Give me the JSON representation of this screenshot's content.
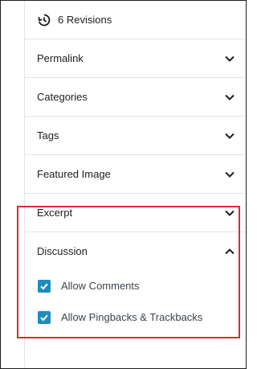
{
  "revisions": {
    "label": "6 Revisions",
    "icon": "history-icon"
  },
  "sections": [
    {
      "label": "Permalink",
      "expanded": false
    },
    {
      "label": "Categories",
      "expanded": false
    },
    {
      "label": "Tags",
      "expanded": false
    },
    {
      "label": "Featured Image",
      "expanded": false
    },
    {
      "label": "Excerpt",
      "expanded": false
    }
  ],
  "discussion": {
    "label": "Discussion",
    "expanded": true,
    "options": [
      {
        "label": "Allow Comments",
        "checked": true
      },
      {
        "label": "Allow Pingbacks & Trackbacks",
        "checked": true
      }
    ]
  },
  "colors": {
    "checkbox": "#1e8cbe",
    "highlight": "#d32f2f",
    "divider": "#e2e4e7"
  }
}
